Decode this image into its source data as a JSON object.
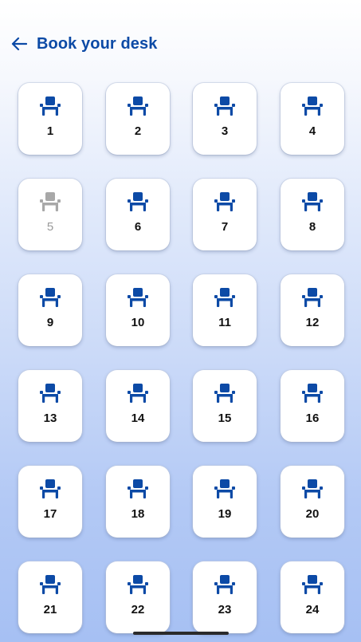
{
  "header": {
    "title": "Book your desk",
    "back_icon": "arrow-left-icon"
  },
  "colors": {
    "accent": "#0c4aa6",
    "available_chair": "#0c4aa6",
    "unavailable_chair": "#a8a8a8"
  },
  "desks": [
    {
      "number": "1",
      "available": true
    },
    {
      "number": "2",
      "available": true
    },
    {
      "number": "3",
      "available": true
    },
    {
      "number": "4",
      "available": true
    },
    {
      "number": "5",
      "available": false
    },
    {
      "number": "6",
      "available": true
    },
    {
      "number": "7",
      "available": true
    },
    {
      "number": "8",
      "available": true
    },
    {
      "number": "9",
      "available": true
    },
    {
      "number": "10",
      "available": true
    },
    {
      "number": "11",
      "available": true
    },
    {
      "number": "12",
      "available": true
    },
    {
      "number": "13",
      "available": true
    },
    {
      "number": "14",
      "available": true
    },
    {
      "number": "15",
      "available": true
    },
    {
      "number": "16",
      "available": true
    },
    {
      "number": "17",
      "available": true
    },
    {
      "number": "18",
      "available": true
    },
    {
      "number": "19",
      "available": true
    },
    {
      "number": "20",
      "available": true
    },
    {
      "number": "21",
      "available": true
    },
    {
      "number": "22",
      "available": true
    },
    {
      "number": "23",
      "available": true
    },
    {
      "number": "24",
      "available": true
    }
  ],
  "desk_icon": "chair-icon"
}
